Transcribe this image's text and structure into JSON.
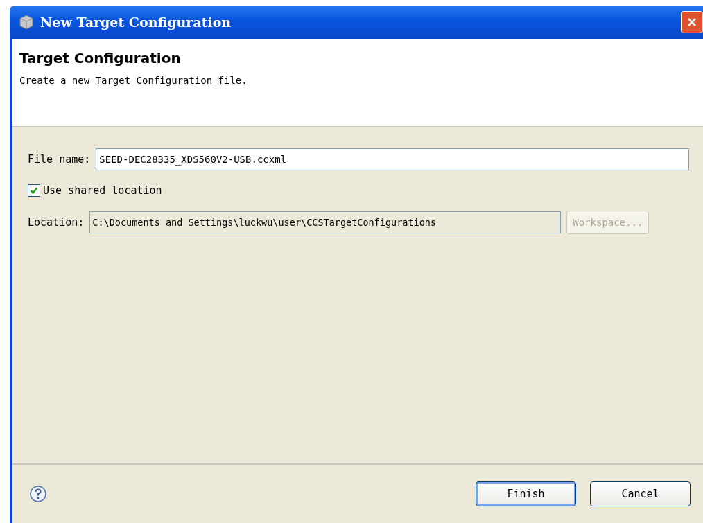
{
  "window": {
    "title": "New Target Configuration"
  },
  "header": {
    "title": "Target Configuration",
    "description": "Create a new Target Configuration file."
  },
  "file_name": {
    "label": "File name:",
    "value": "SEED-DEC28335_XDS560V2-USB.ccxml"
  },
  "shared_location": {
    "label": "Use shared location",
    "checked": true
  },
  "location": {
    "label": "Location:",
    "value": "C:\\Documents and Settings\\luckwu\\user\\CCSTargetConfigurations"
  },
  "workspace_button": {
    "label": "Workspace...",
    "disabled": true
  },
  "buttons": [
    {
      "label": "Finish",
      "default": true
    },
    {
      "label": "Cancel",
      "default": false
    }
  ]
}
